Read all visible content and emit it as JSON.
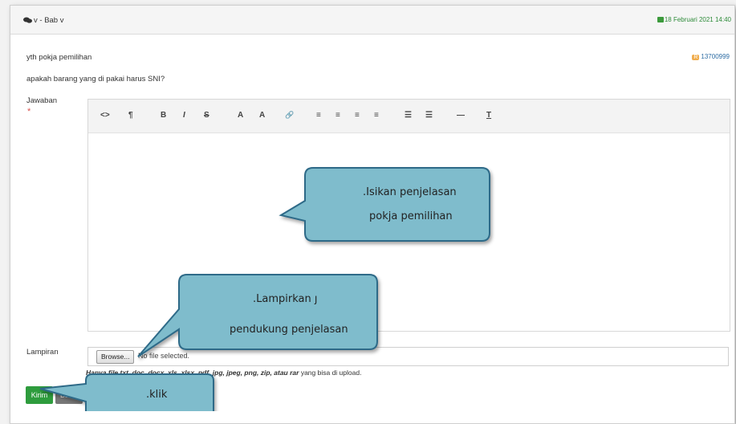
{
  "header": {
    "topic": "v - Bab v",
    "date": "18 Februari 2021 14:40"
  },
  "message": {
    "sender": "yth pokja pemilihan",
    "question": "apakah barang yang di pakai harus SNI?",
    "user_badge": "R",
    "user_id": "13700999"
  },
  "form": {
    "answer_label": "Jawaban",
    "required_mark": "*",
    "attachment_label": "Lampiran",
    "browse_label": "Browse...",
    "file_status": "No file selected.",
    "file_hint_prefix": "Hanya file txt, doc, docx, xls, xlsx, pdf, jpg, jpeg, png, zip, atau rar",
    "file_hint_suffix": " yang bisa di upload.",
    "submit_label": "Kirim",
    "cancel_label": "Batal"
  },
  "toolbar": {
    "code": "<>",
    "paragraph": "¶",
    "bold": "B",
    "italic": "I",
    "strike": "S",
    "superscript": "A",
    "subscript": "A",
    "link": "🔗",
    "align_left": "≡",
    "align_center": "≡",
    "align_right": "≡",
    "justify": "≡",
    "bullet_list": "☰",
    "numbered_list": "☰",
    "horizontal_rule": "—",
    "clear_format": "T"
  },
  "callouts": {
    "editor_line1": ".Isikan penjelasan",
    "editor_line2": "pokja  pemilihan",
    "attach_line1": ".Lampirkan ȷ",
    "attach_line2": "pendukung penjelasan",
    "click": ".klik"
  },
  "colors": {
    "callout_fill": "#7fbccc",
    "callout_stroke": "#2e6a88",
    "submit": "#2e9c3d",
    "date": "#2e8b3a"
  }
}
